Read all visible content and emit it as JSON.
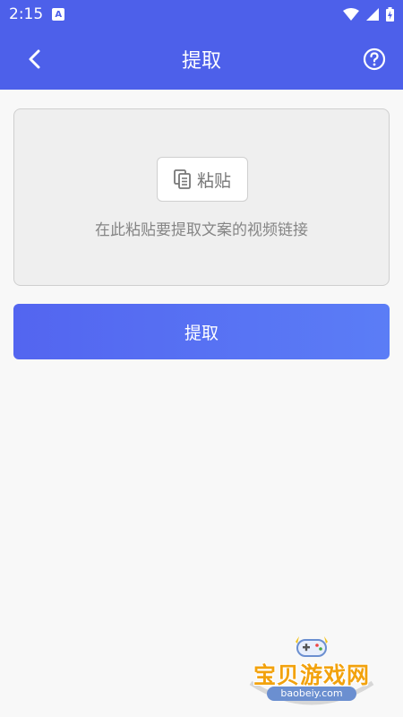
{
  "status_bar": {
    "time": "2:15",
    "notification_icon": "a-icon"
  },
  "app_bar": {
    "title": "提取",
    "back_icon": "chevron-left-icon",
    "help_icon": "question-circle-icon"
  },
  "paste_area": {
    "paste_button_label": "粘贴",
    "hint": "在此粘贴要提取文案的视频链接"
  },
  "extract_button_label": "提取",
  "watermark": {
    "text": "宝贝游戏网",
    "url": "baobeiy.com"
  },
  "colors": {
    "primary": "#4d60ea",
    "button_gradient_start": "#5365f0",
    "button_gradient_end": "#5b7df6",
    "background": "#f8f8f8",
    "paste_area_bg": "#efefef",
    "watermark_text": "#f2a20d"
  }
}
